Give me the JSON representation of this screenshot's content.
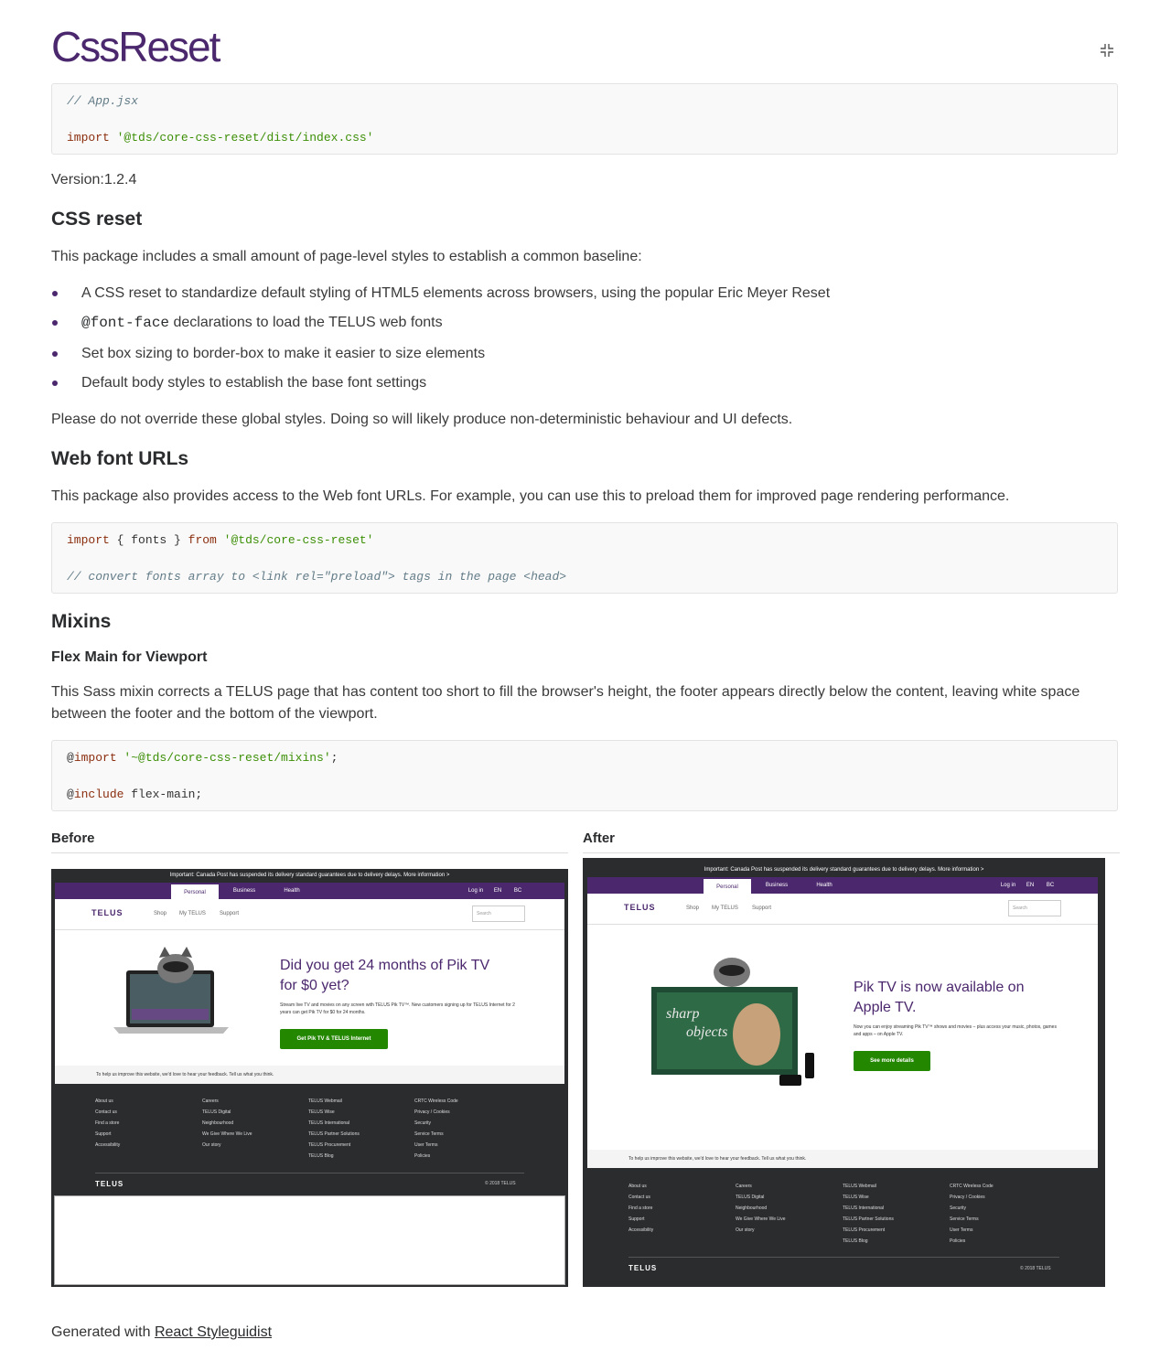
{
  "title": "CssReset",
  "isolate_button": "isolate-icon",
  "code1": {
    "comment": "// App.jsx",
    "kw": "import",
    "str": "'@tds/core-css-reset/dist/index.css'"
  },
  "version": {
    "label": "Version:",
    "value": "1.2.4"
  },
  "section1": {
    "heading": "CSS reset",
    "intro": "This package includes a small amount of page-level styles to establish a common baseline:",
    "items": [
      {
        "text": "A CSS reset to standardize default styling of HTML5 elements across browsers, using the popular Eric Meyer Reset"
      },
      {
        "code": "@font-face",
        "text": " declarations to load the TELUS web fonts"
      },
      {
        "text": "Set box sizing to border-box to make it easier to size elements"
      },
      {
        "text": "Default body styles to establish the base font settings"
      }
    ],
    "warning": "Please do not override these global styles. Doing so will likely produce non-deterministic behaviour and UI defects."
  },
  "section2": {
    "heading": "Web font URLs",
    "intro": "This package also provides access to the Web font URLs. For example, you can use this to preload them for improved page rendering performance.",
    "code": {
      "kw1": "import",
      "plain1": " { fonts } ",
      "kw2": "from",
      "str": " '@tds/core-css-reset'",
      "comment": "// convert fonts array to <link rel=\"preload\"> tags in the page <head>"
    }
  },
  "section3": {
    "heading": "Mixins",
    "subheading": "Flex Main for Viewport",
    "line1": "This Sass mixin corrects a TELUS page that has content too short to fill the browser's height, the footer appears directly below the content, leaving white space",
    "line2": "between the footer and the bottom of the viewport.",
    "code": {
      "at1": "@",
      "kw1": "import",
      "str": " '~@tds/core-css-reset/mixins'",
      "semi": ";",
      "at2": "@",
      "kw2": "include",
      "plain": " flex-main;"
    }
  },
  "compare": {
    "before_label": "Before",
    "after_label": "After",
    "mock": {
      "banner": "Important: Canada Post has suspended its delivery standard guarantees due to delivery delays. More information >",
      "tabs": [
        "Personal",
        "Business",
        "Health"
      ],
      "right_links": [
        "Log in",
        "EN",
        "BC"
      ],
      "logo": "TELUS",
      "nav_links": [
        "Shop",
        "My TELUS",
        "Support"
      ],
      "search": "Search",
      "feedback": "To help us improve this website, we'd love to hear your feedback. Tell us what you think.",
      "footer_cols": [
        [
          "About us",
          "Contact us",
          "Find a store",
          "Support",
          "Accessibility"
        ],
        [
          "Careers",
          "TELUS Digital",
          "Neighbourhood",
          "We Give Where We Live",
          "Our story"
        ],
        [
          "TELUS Webmail",
          "TELUS Wise",
          "TELUS International",
          "TELUS Partner Solutions",
          "TELUS Procurement",
          "TELUS Blog"
        ],
        [
          "CRTC Wireless Code",
          "Privacy / Cookies",
          "Security",
          "Service Terms",
          "User Terms",
          "Policies"
        ]
      ],
      "copyright": "© 2018 TELUS"
    },
    "before": {
      "headline1": "Did you get 24 months of Pik TV",
      "headline2": "for $0 yet?",
      "para": "Stream live TV and movies on any screen with TELUS Pik TV™. New customers signing up for TELUS Internet for 2 years can get Pik TV for $0 for 24 months.",
      "cta": "Get Pik TV & TELUS Internet"
    },
    "after": {
      "headline1": "Pik TV is now available on",
      "headline2": "Apple TV.",
      "para": "Now you can enjoy streaming Pik TV™ shows and movies – plus access your music, photos, games and apps – on Apple TV.",
      "cta": "See more details"
    }
  },
  "footer": {
    "prefix": "Generated with ",
    "link": "React Styleguidist"
  }
}
